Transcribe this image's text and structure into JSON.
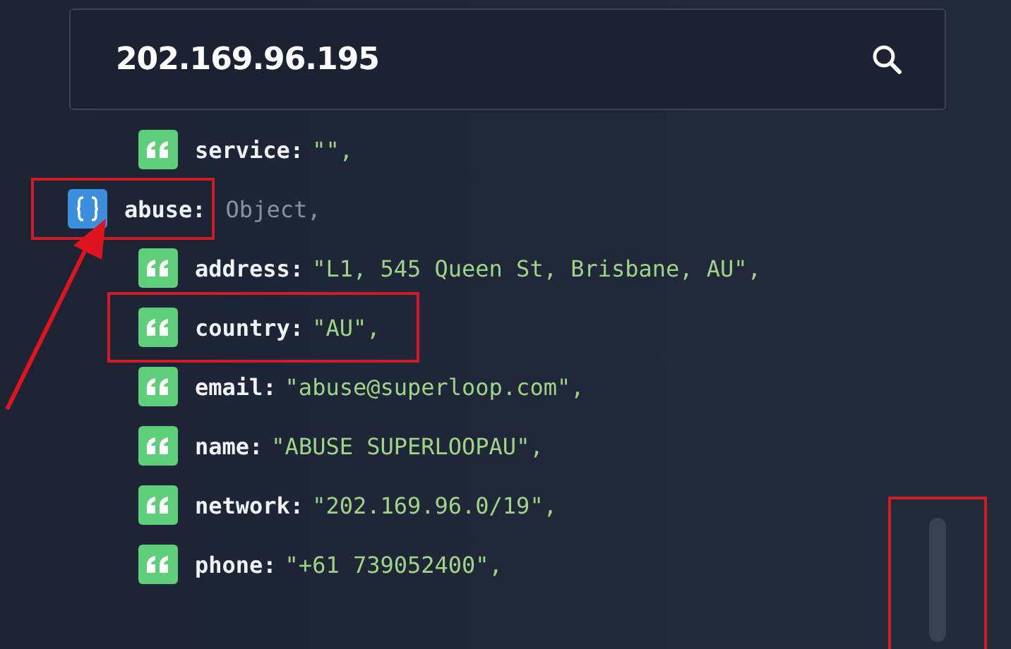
{
  "search": {
    "value": "202.169.96.195"
  },
  "entries": [
    {
      "kind": "group",
      "children": [
        {
          "kind": "string",
          "key": "service:",
          "value": "\"\",",
          "highlighted": false
        }
      ]
    },
    {
      "kind": "object",
      "key": "abuse:",
      "value": "Object,",
      "highlighted": true,
      "pointed": true,
      "children": [
        {
          "kind": "string",
          "key": "address:",
          "value": "\"L1, 545 Queen St, Brisbane, AU\",",
          "highlighted": false
        },
        {
          "kind": "string",
          "key": "country:",
          "value": "\"AU\",",
          "highlighted": true
        },
        {
          "kind": "string",
          "key": "email:",
          "value": "\"abuse@superloop.com\",",
          "highlighted": false
        },
        {
          "kind": "string",
          "key": "name:",
          "value": "\"ABUSE SUPERLOOPAU\",",
          "highlighted": false
        },
        {
          "kind": "string",
          "key": "network:",
          "value": "\"202.169.96.0/19\",",
          "highlighted": false
        },
        {
          "kind": "string",
          "key": "phone:",
          "value": "\"+61 739052400\",",
          "highlighted": false
        }
      ]
    }
  ],
  "scrollbar": {
    "highlighted": true
  }
}
